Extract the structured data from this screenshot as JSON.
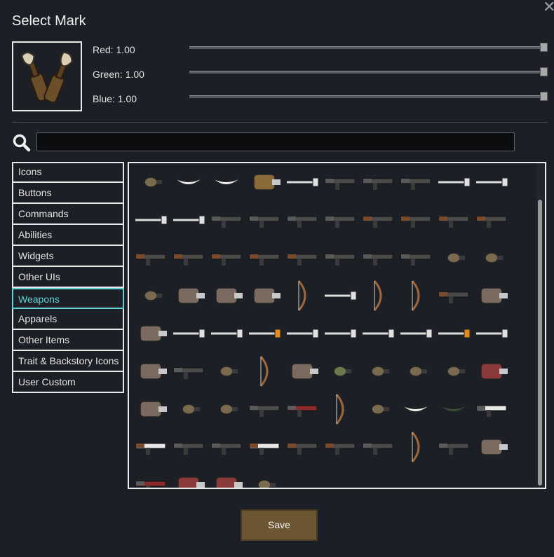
{
  "dialog": {
    "title": "Select Mark",
    "close_icon": "close-icon"
  },
  "preview": {
    "icon": "molotov-cocktail-icon"
  },
  "sliders": [
    {
      "label": "Red: 1.00",
      "value": 1.0
    },
    {
      "label": "Green: 1.00",
      "value": 1.0
    },
    {
      "label": "Blue: 1.00",
      "value": 1.0
    }
  ],
  "search": {
    "icon": "search-icon",
    "value": "",
    "placeholder": ""
  },
  "categories": [
    {
      "label": "Icons"
    },
    {
      "label": "Buttons"
    },
    {
      "label": "Commands"
    },
    {
      "label": "Abilities"
    },
    {
      "label": "Widgets"
    },
    {
      "label": "Other UIs"
    },
    {
      "label": "Weapons"
    },
    {
      "label": "Apparels"
    },
    {
      "label": "Other Items"
    },
    {
      "label": "Trait & Backstory Icons"
    },
    {
      "label": "User Custom"
    }
  ],
  "selected_category": "Weapons",
  "weapon_rows": [
    [
      "grenade-red",
      "knife-curved",
      "tusk",
      "wood-logs",
      "axe",
      "short-knife",
      "dagger",
      "long-knife",
      "spiked-club",
      "short-blade"
    ],
    [
      "spear",
      "long-spear",
      "revolver",
      "pistol",
      "machine-pistol",
      "shotgun",
      "heavy-rifle",
      "plasma-rifle",
      "rifle",
      "hunting-rifle"
    ],
    [
      "assault-rifle",
      "rifle-scoped",
      "rifle",
      "rifle-long",
      "sniper-rifle",
      "minigun",
      "heavy-cannon",
      "gatling",
      "frag-grenades",
      "molotov"
    ],
    [
      "emp-grenades",
      "rocket-launcher",
      "launcher",
      "tube-launcher",
      "short-bow",
      "spear-staff",
      "recurve-bow",
      "long-bow",
      "charge-rifle",
      "pike-launcher"
    ],
    [
      "round-shield",
      "staff",
      "mace",
      "orange-blade",
      "hatchet",
      "bright-blade",
      "light-blade",
      "warhammer",
      "orange-sword",
      "pole"
    ],
    [
      "spike-launcher",
      "smg-green",
      "tox-grenades",
      "greatbow",
      "incendiary-pack",
      "bottle-green",
      "bottle-brown",
      "small-bottle",
      "lantern",
      "barrel-pack"
    ],
    [
      "thorn-cannon",
      "bolt",
      "bullet",
      "shotgun-dark",
      "shotgun-red",
      "crossbow",
      "mine",
      "tusk-large",
      "scythe",
      "revolver-light"
    ],
    [
      "white-rifle",
      "carbine",
      "assault-gun",
      "light-rifle",
      "battle-rifle",
      "rifle-thin",
      "chaingun",
      "recurve-bow",
      "drill-gun",
      "claw-launcher"
    ],
    [
      "red-gun",
      "canister-red",
      "canister-barrel",
      "ammo-bottle"
    ]
  ],
  "scrollbar": {
    "position": 0.11
  },
  "footer": {
    "save_label": "Save"
  },
  "colors": {
    "accent_selected": "#5fd4d4",
    "save_button": "#6b5533",
    "background": "#1c2026"
  }
}
